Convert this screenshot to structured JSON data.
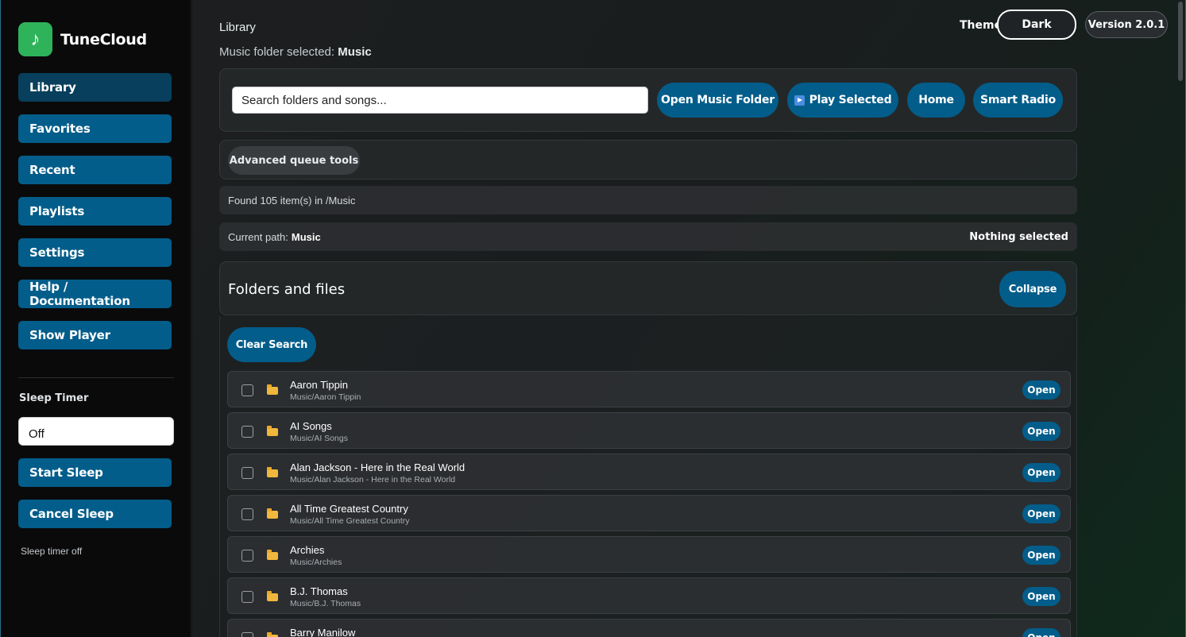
{
  "brand": {
    "name": "TuneCloud",
    "logo_glyph": "♪",
    "logo_color": "#2fb35a"
  },
  "sidebar": {
    "nav": [
      {
        "label": "Library",
        "active": true
      },
      {
        "label": "Favorites"
      },
      {
        "label": "Recent"
      },
      {
        "label": "Playlists"
      },
      {
        "label": "Settings"
      },
      {
        "label": "Help / Documentation"
      },
      {
        "label": "Show Player"
      }
    ],
    "sleep": {
      "label": "Sleep Timer",
      "selected": "Off",
      "start_label": "Start Sleep",
      "cancel_label": "Cancel Sleep",
      "status": "Sleep timer off"
    }
  },
  "header": {
    "title": "Library",
    "folder_prefix": "Music folder selected:",
    "folder_name": "Music",
    "theme_label": "Theme",
    "theme_value": "Dark",
    "version": "Version 2.0.1"
  },
  "toolbar": {
    "search_placeholder": "Search folders and songs...",
    "open_folder": "Open Music Folder",
    "play_selected": "Play Selected",
    "home": "Home",
    "smart_radio": "Smart Radio"
  },
  "tools": {
    "advanced": "Advanced queue tools"
  },
  "status": {
    "found": "Found 105 item(s) in /Music",
    "path_prefix": "Current path:",
    "path_value": "Music",
    "selection": "Nothing selected"
  },
  "files": {
    "title": "Folders and files",
    "collapse": "Collapse",
    "clear_search": "Clear Search",
    "open_label": "Open",
    "items": [
      {
        "name": "Aaron Tippin",
        "path": "Music/Aaron Tippin"
      },
      {
        "name": "AI Songs",
        "path": "Music/AI Songs"
      },
      {
        "name": "Alan Jackson - Here in the Real World",
        "path": "Music/Alan Jackson - Here in the Real World"
      },
      {
        "name": "All Time Greatest Country",
        "path": "Music/All Time Greatest Country"
      },
      {
        "name": "Archies",
        "path": "Music/Archies"
      },
      {
        "name": "B.J. Thomas",
        "path": "Music/B.J. Thomas"
      },
      {
        "name": "Barry Manilow",
        "path": ""
      }
    ]
  },
  "colors": {
    "accent": "#035d8a",
    "active_nav": "#073f5c",
    "folder": "#f0b73c"
  }
}
